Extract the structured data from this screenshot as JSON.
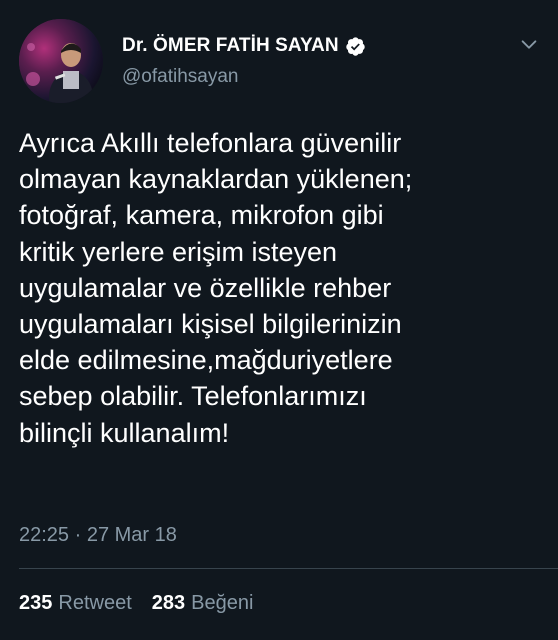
{
  "author": {
    "display_name": "Dr. ÖMER FATİH SAYAN",
    "handle": "@ofatihsayan",
    "verified": true
  },
  "tweet": {
    "text": "Ayrıca Akıllı telefonlara güvenilir\nolmayan kaynaklardan yüklenen;\nfotoğraf, kamera, mikrofon gibi\nkritik yerlere erişim isteyen\nuygulamalar ve özellikle rehber\nuygulamaları kişisel bilgilerinizin\nelde edilmesine,mağduriyetlere\nsebep olabilir. Telefonlarımızı\nbilinçli kullanalım!",
    "timestamp": "22:25 · 27 Mar 18"
  },
  "stats": {
    "retweet_count": "235",
    "retweet_label": "Retweet",
    "like_count": "283",
    "like_label": "Beğeni"
  },
  "icons": {
    "verified": "verified-badge-icon",
    "menu": "chevron-down-icon"
  },
  "colors": {
    "background": "#10171e",
    "text": "#ffffff",
    "secondary_text": "#8899a6",
    "divider": "#38444d"
  }
}
